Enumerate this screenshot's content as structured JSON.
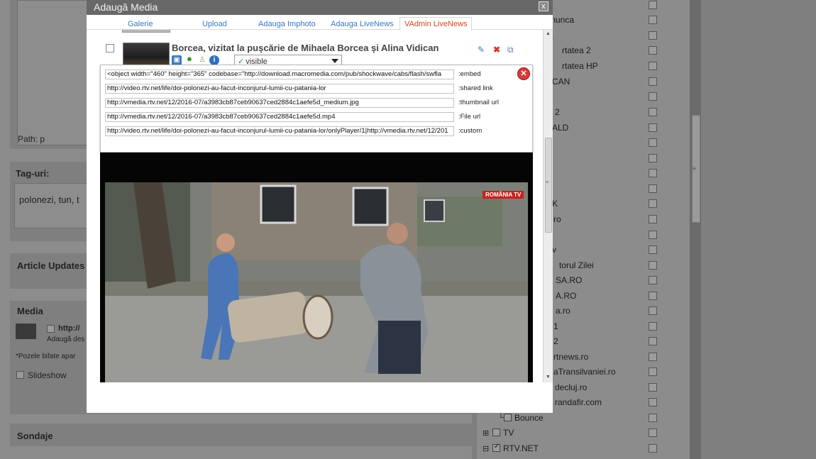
{
  "background": {
    "path_label": "Path: p",
    "tags_heading": "Tag-uri:",
    "tags_value": "polonezi, tun, t",
    "article_updates_heading": "Article Updates",
    "media_heading": "Media",
    "media_item_url": "http://",
    "media_item_sub": "Adaugă des",
    "media_note": "*Pozele bifate apar",
    "slideshow_label": "Slideshow",
    "sondaje_heading": "Sondaje",
    "categories": [
      {
        "label": "munca"
      },
      {
        "label": "a"
      },
      {
        "label": "rtatea 2"
      },
      {
        "label": "rtatea HP"
      },
      {
        "label": "CAN"
      },
      {
        "label": ""
      },
      {
        "label": "2"
      },
      {
        "label": "ALD"
      },
      {
        "label": ""
      },
      {
        "label": ""
      },
      {
        "label": ""
      },
      {
        "label": ""
      },
      {
        "label": "K"
      },
      {
        "label": "ro"
      },
      {
        "label": ""
      },
      {
        "label": "v"
      },
      {
        "label": "torul Zilei"
      },
      {
        "label": "SA.RO"
      },
      {
        "label": "A.RO"
      },
      {
        "label": "a.ro"
      },
      {
        "label": "1"
      },
      {
        "label": "2"
      },
      {
        "label": "rtnews.ro"
      },
      {
        "label": "aTransilvaniei.ro"
      },
      {
        "label": "decluj.ro"
      },
      {
        "label": "randafir.com"
      },
      {
        "label": "Bounce",
        "checked": false
      },
      {
        "label": "TV",
        "checked": false
      },
      {
        "label": "RTV.NET",
        "checked": true
      }
    ]
  },
  "modal": {
    "title": "Adaugă Media",
    "close_symbol": "x",
    "tabs": [
      {
        "label": "Galerie"
      },
      {
        "label": "Upload"
      },
      {
        "label": "Adauga Imphoto"
      },
      {
        "label": "Adauga LiveNews"
      },
      {
        "label": "VAdmin LiveNews",
        "active": true
      }
    ],
    "item": {
      "title": "Borcea, vizitat la pușcărie de Mihaela Borcea și Alina Vidican",
      "visibility": "visible",
      "icons": [
        "image-icon",
        "gear-icon",
        "person-icon",
        "info-icon"
      ],
      "actions": [
        "edit-icon",
        "delete-icon",
        "copy-icon"
      ]
    },
    "embed": {
      "fields": [
        {
          "value": "<object width=\"460\" height=\"365\" codebase=\"http://download.macromedia.com/pub/shockwave/cabs/flash/swfla",
          "label": ":embed"
        },
        {
          "value": "http://video.rtv.net/life/doi-polonezi-au-facut-inconjurul-lumii-cu-patania-lor",
          "label": ":shared link"
        },
        {
          "value": "http://vmedia.rtv.net/12/2016-07/a3983cb87ceb90637ced2884c1aefe5d_medium.jpg",
          "label": ":thumbnail url"
        },
        {
          "value": "http://vmedia.rtv.net/12/2016-07/a3983cb87ceb90637ced2884c1aefe5d.mp4",
          "label": ":File url"
        },
        {
          "value": "http://video.rtv.net/life/doi-polonezi-au-facut-inconjurul-lumii-cu-patania-lor/onlyPlayer/1|http://vmedia.rtv.net/12/201",
          "label": ":custom"
        }
      ],
      "close_symbol": "✕"
    },
    "video": {
      "watermark": "ROMÂNIA TV"
    }
  },
  "colors": {
    "tab_link": "#3879c2",
    "tab_active": "#d9441f",
    "titlebar": "#686868",
    "close_red": "#d93a3a"
  }
}
